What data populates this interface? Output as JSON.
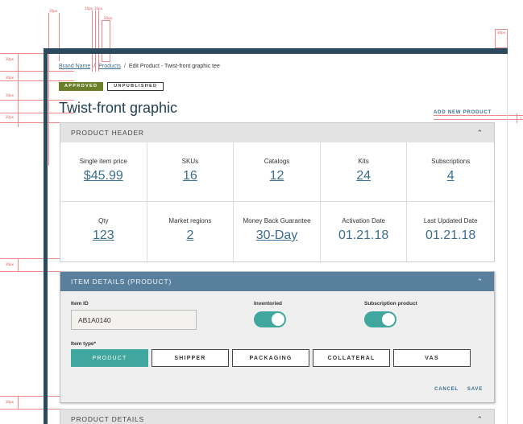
{
  "spec_annotations": {
    "left_col": [
      "30px",
      "30px",
      "30px",
      "20px",
      "30px",
      "30px"
    ],
    "top_row": [
      "30px",
      "10px",
      "10px",
      "20px"
    ],
    "right": [
      "30px",
      "2"
    ]
  },
  "breadcrumb": {
    "items": [
      "Brand Name",
      "Products"
    ],
    "current": "Edit Product - Twist-front graphic tee",
    "separator": "/"
  },
  "badges": {
    "approved": "APPROVED",
    "unpublished": "UNPUBLISHED"
  },
  "page_title": "Twist-front graphic",
  "add_new_label": "ADD NEW PRODUCT",
  "product_header": {
    "title": "PRODUCT HEADER",
    "stats": [
      {
        "label": "Single item price",
        "value": "$45.99"
      },
      {
        "label": "SKUs",
        "value": "16"
      },
      {
        "label": "Catalogs",
        "value": "12"
      },
      {
        "label": "Kits",
        "value": "24"
      },
      {
        "label": "Subscriptions",
        "value": "4"
      },
      {
        "label": "Qty",
        "value": "123"
      },
      {
        "label": "Market regions",
        "value": "2"
      },
      {
        "label": "Money Back Guarantee",
        "value": "30-Day"
      },
      {
        "label": "Activation Date",
        "value": "01.21.18"
      },
      {
        "label": "Last Updated Date",
        "value": "01.21.18"
      }
    ]
  },
  "item_details": {
    "title": "ITEM DETAILS (PRODUCT)",
    "item_id_label": "Item ID",
    "item_id_value": "AB1A0140",
    "inventoried_label": "Inventoried",
    "inventoried_on": true,
    "subscription_label": "Subscription product",
    "subscription_on": true,
    "item_type_label": "Item type*",
    "item_types": [
      "PRODUCT",
      "SHIPPER",
      "PACKAGING",
      "COLLATERAL",
      "VAS"
    ],
    "selected_type": "PRODUCT",
    "cancel_label": "CANCEL",
    "save_label": "SAVE"
  },
  "product_details": {
    "title": "PRODUCT DETAILS"
  },
  "colors": {
    "frame": "#2c4a5e",
    "accent_link": "#3b6e8f",
    "approved": "#6b7f28",
    "teal": "#3fa79d",
    "panel_blue": "#587f9b"
  }
}
